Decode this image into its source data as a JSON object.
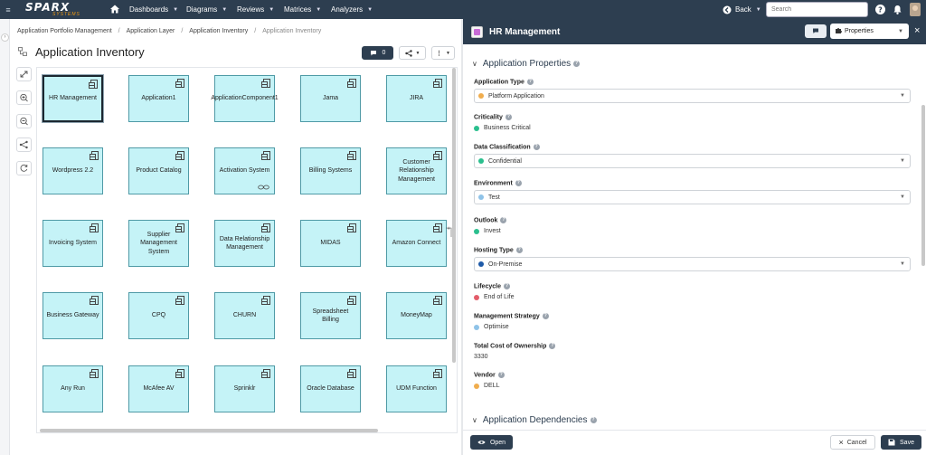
{
  "topbar": {
    "logo_main": "SPARX",
    "logo_sub": "SYSTEMS",
    "menus": [
      {
        "label": "Dashboards"
      },
      {
        "label": "Diagrams"
      },
      {
        "label": "Reviews"
      },
      {
        "label": "Matrices"
      },
      {
        "label": "Analyzers"
      }
    ],
    "back_label": "Back",
    "search_placeholder": "Search"
  },
  "breadcrumb": [
    "Application Portfolio Management",
    "Application Layer",
    "Application Inventory",
    "Application Inventory"
  ],
  "diagram": {
    "title": "Application Inventory",
    "comment_count": "0",
    "nodes": [
      {
        "label": "HR Management",
        "selected": true
      },
      {
        "label": "Application1"
      },
      {
        "label": "ApplicationComponent1"
      },
      {
        "label": "Jama"
      },
      {
        "label": "JIRA"
      },
      {
        "label": "Wordpress 2.2"
      },
      {
        "label": "Product Catalog"
      },
      {
        "label": "Activation System",
        "linked": true
      },
      {
        "label": "Billing Systems"
      },
      {
        "label": "Customer Relationship Management"
      },
      {
        "label": "Invoicing System"
      },
      {
        "label": "Supplier Management System"
      },
      {
        "label": "Data Relationship Management"
      },
      {
        "label": "MIDAS"
      },
      {
        "label": "Amazon Connect"
      },
      {
        "label": "Business Gateway"
      },
      {
        "label": "CPQ"
      },
      {
        "label": "CHURN"
      },
      {
        "label": "Spreadsheet Billing"
      },
      {
        "label": "MoneyMap"
      },
      {
        "label": "Any Run"
      },
      {
        "label": "McAfee AV"
      },
      {
        "label": "Sprinklr"
      },
      {
        "label": "Oracle Database"
      },
      {
        "label": "UDM Function"
      }
    ]
  },
  "panel": {
    "title": "HR Management",
    "view_select": "Properties",
    "section1": "Application Properties",
    "section2": "Application Dependencies",
    "fields": [
      {
        "label": "Application Type",
        "value": "Platform Application",
        "dot": "#f0ad4e",
        "dropdown": true
      },
      {
        "label": "Criticality",
        "value": "Business Critical",
        "dot": "#2bbf8e",
        "dropdown": false
      },
      {
        "label": "Data Classification",
        "value": "Confidential",
        "dot": "#2bbf8e",
        "dropdown": true
      },
      {
        "label": "Environment",
        "value": "Test",
        "dot": "#8fc3e8",
        "dropdown": true
      },
      {
        "label": "Outlook",
        "value": "Invest",
        "dot": "#2bbf8e",
        "dropdown": false
      },
      {
        "label": "Hosting Type",
        "value": "On-Premise",
        "dot": "#1e5aa8",
        "dropdown": true
      },
      {
        "label": "Lifecycle",
        "value": "End of Life",
        "dot": "#e35d6a",
        "dropdown": false
      },
      {
        "label": "Management Strategy",
        "value": "Optimise",
        "dot": "#8fc3e8",
        "dropdown": false
      },
      {
        "label": "Total Cost of Ownership",
        "value": "3330",
        "dot": "",
        "dropdown": false
      },
      {
        "label": "Vendor",
        "value": "DELL",
        "dot": "#f0ad4e",
        "dropdown": false
      }
    ],
    "open_label": "Open",
    "cancel_label": "Cancel",
    "save_label": "Save"
  },
  "colors": {
    "topbar": "#2d3e50",
    "node_fill": "#c5f3f7",
    "node_border": "#4f9aa6"
  }
}
